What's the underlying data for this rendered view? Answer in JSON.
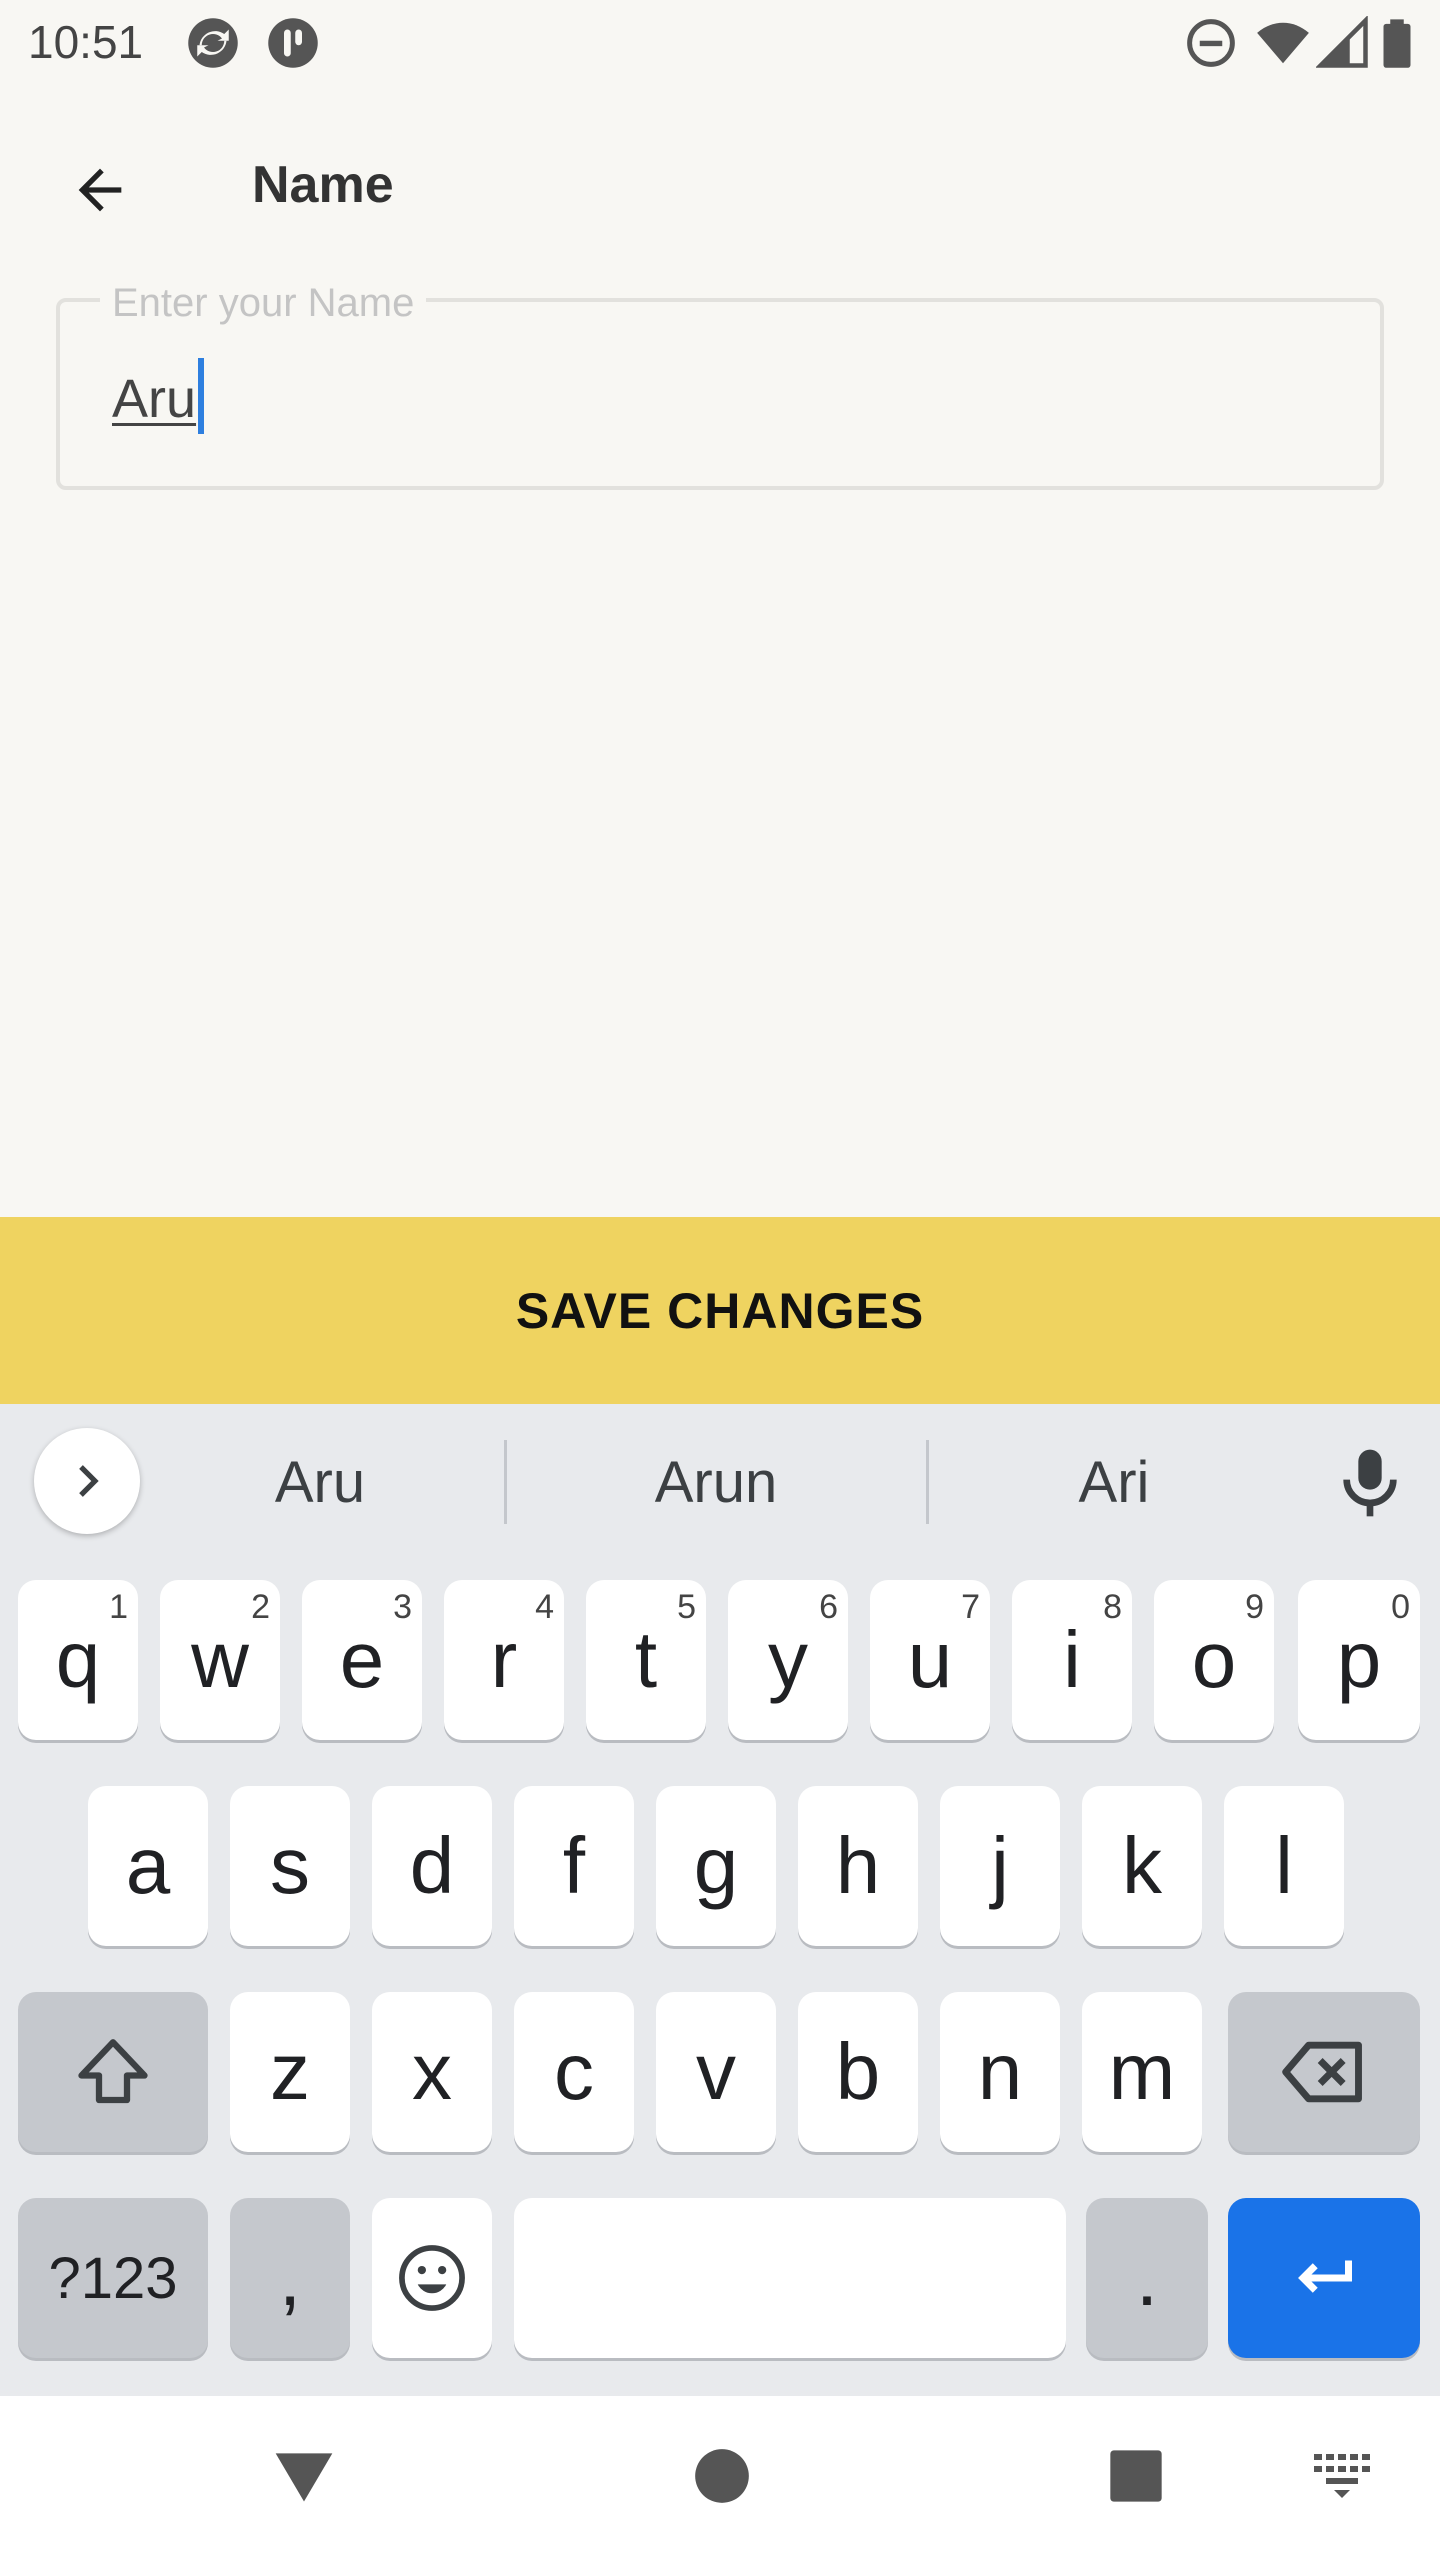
{
  "status_bar": {
    "time": "10:51",
    "icons": [
      "sync-app-icon",
      "pocket-app-icon",
      "dnd-icon",
      "wifi-icon",
      "signal-icon",
      "battery-icon"
    ]
  },
  "header": {
    "back_icon": "arrow-back-icon",
    "title": "Name"
  },
  "name_field": {
    "label": "Enter your Name",
    "value": "Aru"
  },
  "save_button": {
    "label": "SAVE CHANGES",
    "color": "#efd360"
  },
  "keyboard": {
    "suggestions": [
      "Aru",
      "Arun",
      "Ari"
    ],
    "row1": [
      {
        "k": "q",
        "h": "1"
      },
      {
        "k": "w",
        "h": "2"
      },
      {
        "k": "e",
        "h": "3"
      },
      {
        "k": "r",
        "h": "4"
      },
      {
        "k": "t",
        "h": "5"
      },
      {
        "k": "y",
        "h": "6"
      },
      {
        "k": "u",
        "h": "7"
      },
      {
        "k": "i",
        "h": "8"
      },
      {
        "k": "o",
        "h": "9"
      },
      {
        "k": "p",
        "h": "0"
      }
    ],
    "row2": [
      "a",
      "s",
      "d",
      "f",
      "g",
      "h",
      "j",
      "k",
      "l"
    ],
    "row3": [
      "z",
      "x",
      "c",
      "v",
      "b",
      "n",
      "m"
    ],
    "symbols_label": "?123",
    "comma": ",",
    "period": ".",
    "accent_color": "#1a73e8"
  },
  "nav_bar": {
    "icons": [
      "back-triangle-icon",
      "home-circle-icon",
      "recents-square-icon",
      "keyboard-switch-icon"
    ]
  }
}
